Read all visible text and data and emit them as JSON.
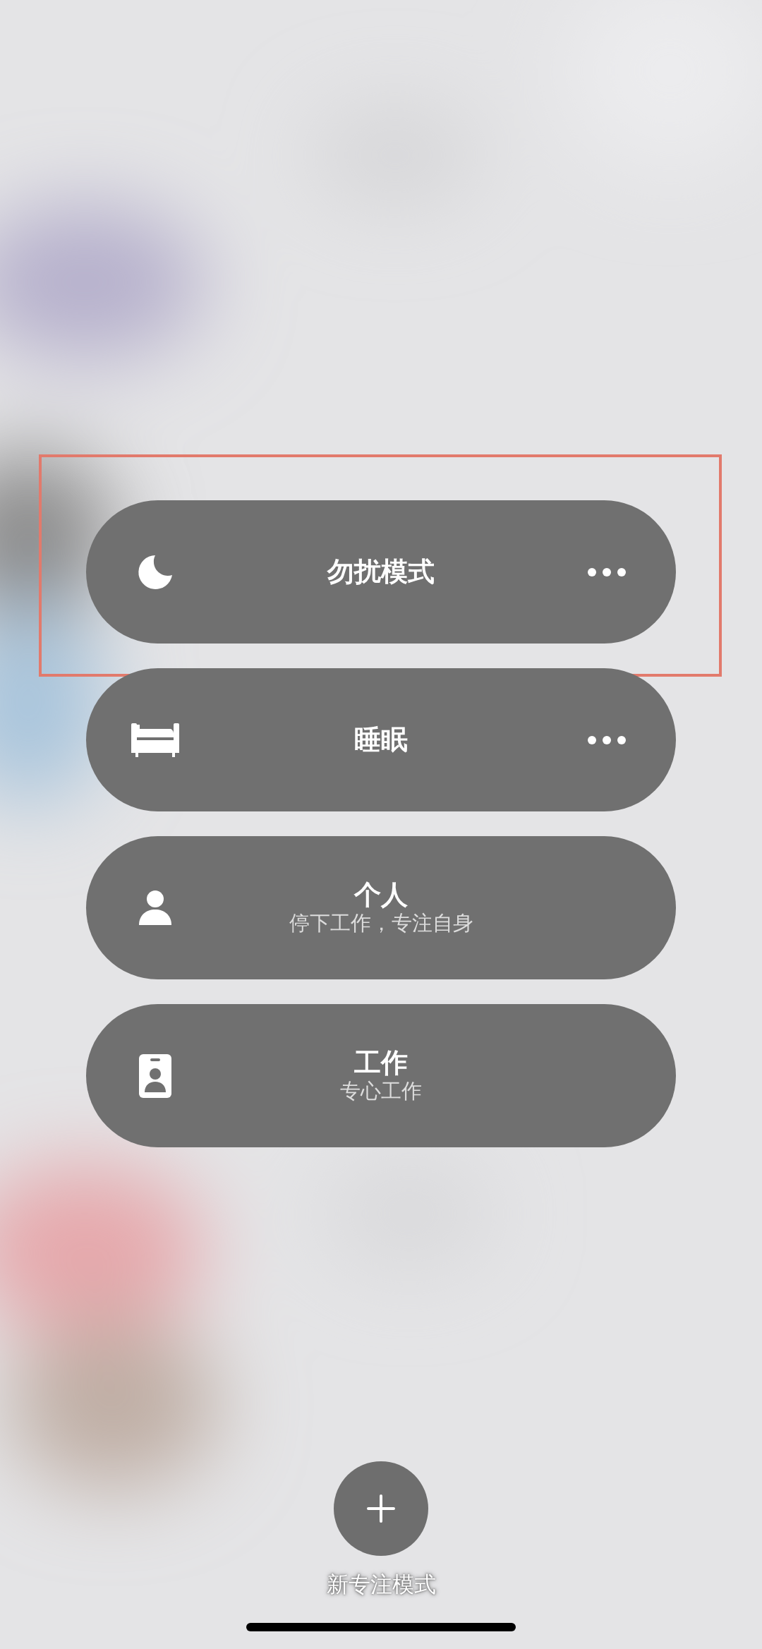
{
  "modes": [
    {
      "kind": "moon",
      "title": "勿扰模式",
      "has_more": true,
      "highlighted": true
    },
    {
      "kind": "bed",
      "title": "睡眠",
      "has_more": true,
      "highlighted": false
    },
    {
      "kind": "person",
      "title": "个人",
      "subtitle": "停下工作，专注自身",
      "has_more": false,
      "highlighted": false
    },
    {
      "kind": "badge",
      "title": "工作",
      "subtitle": "专心工作",
      "has_more": false,
      "highlighted": false
    }
  ],
  "new_mode": {
    "label": "新专注模式"
  }
}
